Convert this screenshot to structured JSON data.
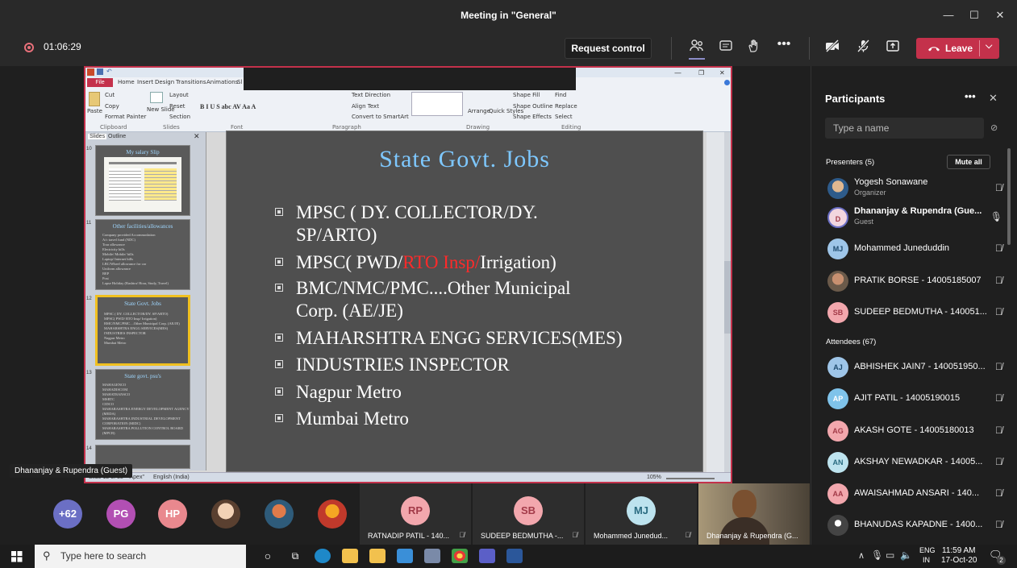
{
  "window": {
    "title": "Meeting in \"General\"",
    "min": "—",
    "max": "☐",
    "close": "✕"
  },
  "call": {
    "duration": "01:06:29",
    "request_control": "Request control",
    "leave": "Leave",
    "accent": "#c4314b"
  },
  "ppt": {
    "file_tab": "File",
    "tabs": [
      "Home",
      "Insert",
      "Design",
      "Transitions",
      "Animations",
      "Sl"
    ],
    "clipboard": [
      "Cut",
      "Copy",
      "Format Painter"
    ],
    "paste": "Paste",
    "slides_group": [
      "Layout",
      "Reset",
      "Section"
    ],
    "new_slide": "New Slide",
    "group_labels": [
      "Clipboard",
      "Slides",
      "Font",
      "Paragraph",
      "Drawing",
      "Editing"
    ],
    "paragraph_opts": [
      "Text Direction",
      "Align Text",
      "Convert to SmartArt"
    ],
    "drawing_opts": [
      "Shape Fill",
      "Shape Outline",
      "Shape Effects"
    ],
    "arrange": "Arrange",
    "quick_styles": "Quick Styles",
    "editing": [
      "Find",
      "Replace",
      "Select"
    ],
    "panel_tabs": [
      "Slides",
      "Outline"
    ],
    "thumbs": [
      {
        "num": "10",
        "title": "My salary Slip"
      },
      {
        "num": "11",
        "title": "Other facilities/allowances",
        "lines": [
          "Company provided Accommodation",
          "A/c travel fund (NDC)",
          "Tour allowance",
          "Electricity bills",
          "Mobile/ Mobile/ bills",
          "Laptop/ Internet bills",
          "LBC/Wheel allowance for car",
          "Uniform allowance",
          "BEP",
          "Post",
          "Lapse Holiday (Rashtra/ Hour, Study, Travel)"
        ]
      },
      {
        "num": "12",
        "title": "State Govt. Jobs",
        "lines": [
          "MPSC ( DY. COLLECTOR/DY. SP/ARTO)",
          "MPSC( PWD/ RTO Insp/ Irrigation)",
          "BMC/NMC/PMC....Other Municipal Corp. (AE/JE)",
          "MAHARSHTRA ENGG SERVICES(MES)",
          "INDUSTRIES INSPECTOR",
          "Nagpur Metro",
          "Mumbai Metro"
        ]
      },
      {
        "num": "13",
        "title": "State govt. psu's",
        "lines": [
          "MAHAGENCO",
          "MAHADISCOM",
          "MAHATRANSCO",
          "MSRTC",
          "CIDCO",
          "MAHARASHTRA ENERGY DEVELOPMENT AGENCY (MEDA)",
          "MAHARASHTRA INDUSTRIAL DEVELOPMENT CORPORATION (MIDC)",
          "MAHARASHTRA POLLUTION CONTROL BOARD (MPCB)"
        ]
      },
      {
        "num": "14"
      }
    ],
    "slide": {
      "title": "State Govt. Jobs",
      "bullets": [
        {
          "line1": "MPSC ( DY. COLLECTOR/DY.",
          "line2": "SP/ARTO)"
        },
        {
          "pre": "MPSC( PWD/",
          "red": "RTO Insp/",
          "post": "Irrigation)"
        },
        {
          "line1": "BMC/NMC/PMC....Other Municipal",
          "line2": "Corp. (AE/JE)"
        },
        {
          "line1": "MAHARSHTRA ENGG SERVICES(MES)"
        },
        {
          "line1": "INDUSTRIES INSPECTOR"
        },
        {
          "line1": "Nagpur Metro"
        },
        {
          "line1": "Mumbai Metro"
        }
      ],
      "title_color": "#7ec8ff",
      "red_color": "#ff2a2a"
    },
    "status": {
      "slide_of": "Slide 12 of 38",
      "theme": "\"Apex\"",
      "lang": "English (India)",
      "zoom": "105%"
    }
  },
  "sharer_label": "Dhananjay & Rupendra (Guest)",
  "strip": {
    "overflow": "+62",
    "avatars": [
      {
        "initials": "PG",
        "color": "#b24fb3"
      },
      {
        "initials": "HP",
        "color": "#e9888e"
      }
    ],
    "tiles": [
      {
        "initials": "RP",
        "name": "RATNADIP PATIL - 140...",
        "color": "#f2a7ad"
      },
      {
        "initials": "SB",
        "name": "SUDEEP BEDMUTHA -...",
        "color": "#f2a7ad"
      },
      {
        "initials": "MJ",
        "name": "Mohammed Junedud...",
        "color": "#bde3ee"
      }
    ],
    "video_name": "Dhananjay & Rupendra (G..."
  },
  "participants": {
    "title": "Participants",
    "search_placeholder": "Type a name",
    "presenters_label": "Presenters (5)",
    "mute_all": "Mute all",
    "attendees_label": "Attendees (67)",
    "presenters": [
      {
        "initials": "",
        "name": "Yogesh Sonawane",
        "sub": "Organizer",
        "color": "#4a6d8c",
        "photo": true
      },
      {
        "initials": "D",
        "name": "Dhananjay & Rupendra (Gue...",
        "sub": "Guest",
        "color": "#f2d6df",
        "ring": true
      },
      {
        "initials": "MJ",
        "name": "Mohammed Juneduddin",
        "color": "#9ec5e8"
      },
      {
        "initials": "",
        "name": "PRATIK BORSE - 14005185007",
        "color": "#6b5a4a",
        "photo": true
      },
      {
        "initials": "SB",
        "name": "SUDEEP BEDMUTHA - 140051...",
        "color": "#f2a7ad"
      }
    ],
    "attendees": [
      {
        "initials": "AJ",
        "name": "ABHISHEK JAIN7 - 140051950...",
        "color": "#9ec5e8"
      },
      {
        "initials": "AP",
        "name": "AJIT PATIL - 14005190015",
        "color": "#7fc3ea"
      },
      {
        "initials": "AG",
        "name": "AKASH GOTE - 14005180013",
        "color": "#f2a7ad"
      },
      {
        "initials": "AN",
        "name": "AKSHAY NEWADKAR - 14005...",
        "color": "#bde3ee"
      },
      {
        "initials": "AA",
        "name": "AWAISAHMAD ANSARI - 140...",
        "color": "#f2a7ad"
      },
      {
        "initials": "",
        "name": "BHANUDAS KAPADNE - 1400...",
        "color": "#444",
        "photo": true
      }
    ]
  },
  "taskbar": {
    "search_placeholder": "Type here to search",
    "lang": "ENG",
    "region": "IN",
    "time": "11:59 AM",
    "date": "17-Oct-20",
    "notif_count": "2"
  }
}
